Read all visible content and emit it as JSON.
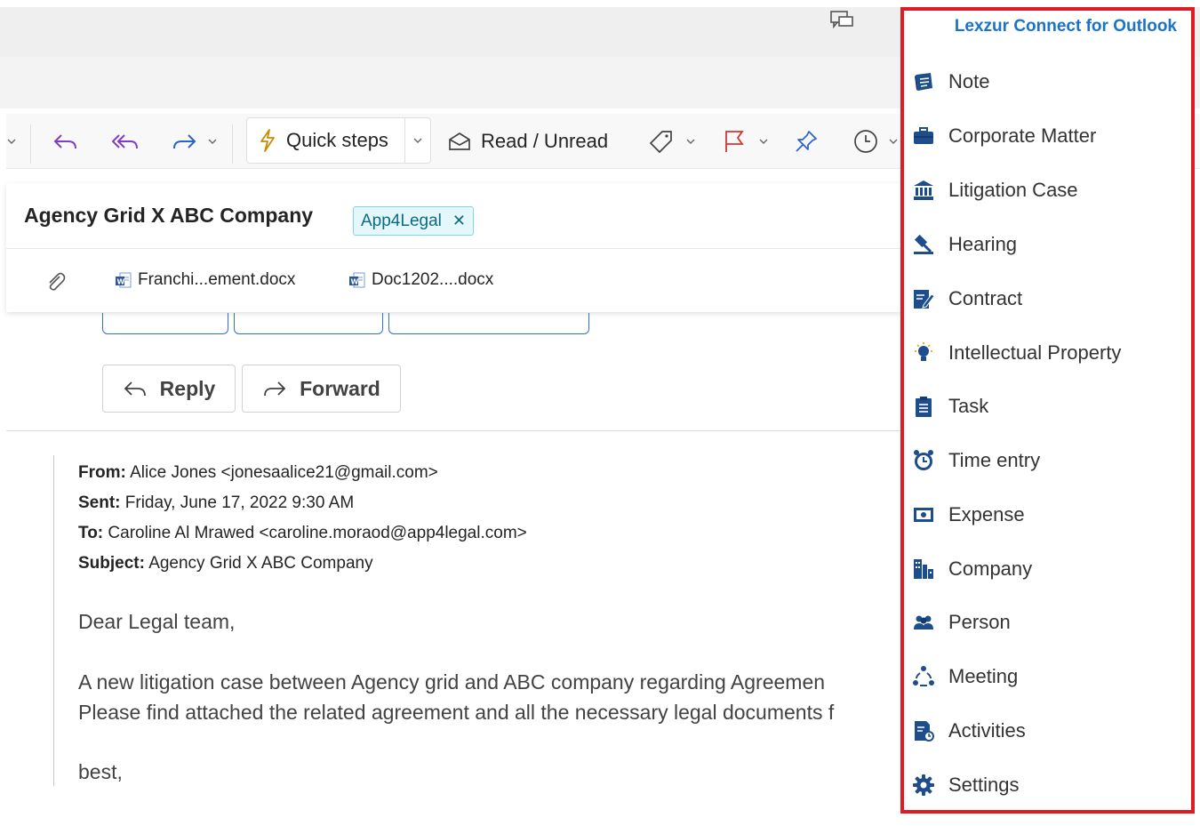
{
  "toolbar": {
    "quick_steps": "Quick steps",
    "read_unread": "Read / Unread"
  },
  "message": {
    "subject": "Agency Grid X ABC Company",
    "tag": "App4Legal",
    "attachments": [
      "Franchi...ement.docx",
      "Doc1202....docx"
    ],
    "reply": "Reply",
    "forward": "Forward",
    "from_label": "From:",
    "from_value": "Alice Jones <jonesaalice21@gmail.com>",
    "sent_label": "Sent:",
    "sent_value": "Friday, June 17, 2022 9:30 AM",
    "to_label": "To:",
    "to_value": "Caroline Al Mrawed <caroline.moraod@app4legal.com>",
    "subject_label": "Subject:",
    "subject_value": "Agency Grid X ABC Company",
    "greeting": "Dear Legal team,",
    "line1": "A new litigation case between Agency grid and ABC company regarding Agreemen",
    "line2": "Please find attached the related agreement and all the necessary legal documents f",
    "closing": "best,"
  },
  "panel": {
    "title": "Lexzur Connect for Outlook",
    "border_color": "#e01b24",
    "icon_color": "#1e4d8c",
    "items": [
      {
        "label": "Note",
        "icon": "note-icon"
      },
      {
        "label": "Corporate Matter",
        "icon": "briefcase-icon"
      },
      {
        "label": "Litigation Case",
        "icon": "courthouse-icon"
      },
      {
        "label": "Hearing",
        "icon": "gavel-icon"
      },
      {
        "label": "Contract",
        "icon": "contract-edit-icon"
      },
      {
        "label": "Intellectual Property",
        "icon": "lightbulb-icon"
      },
      {
        "label": "Task",
        "icon": "clipboard-icon"
      },
      {
        "label": "Time entry",
        "icon": "alarm-clock-icon"
      },
      {
        "label": "Expense",
        "icon": "money-icon"
      },
      {
        "label": "Company",
        "icon": "building-icon"
      },
      {
        "label": "Person",
        "icon": "people-icon"
      },
      {
        "label": "Meeting",
        "icon": "meeting-icon"
      },
      {
        "label": "Activities",
        "icon": "activities-icon"
      },
      {
        "label": "Settings",
        "icon": "gear-icon"
      }
    ]
  }
}
